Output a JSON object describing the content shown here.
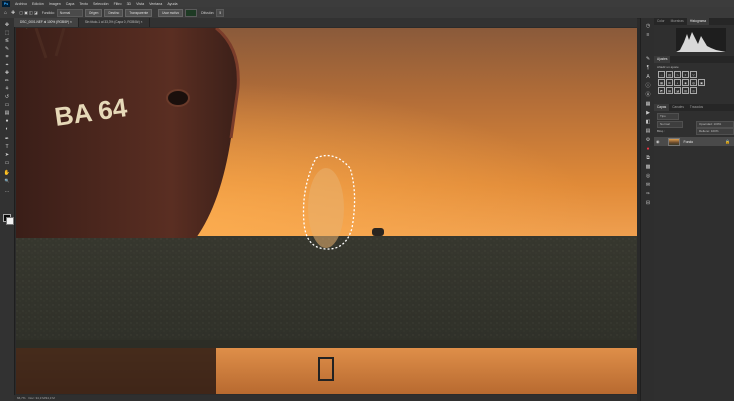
{
  "app": {
    "logo": "Ps"
  },
  "menu": [
    "Archivo",
    "Edición",
    "Imagen",
    "Capa",
    "Texto",
    "Selección",
    "Filtro",
    "3D",
    "Vista",
    "Ventana",
    "Ayuda"
  ],
  "options": {
    "feather_label": "Fundido:",
    "feather_value": "Normal",
    "origin_label": "Origen",
    "dest_label": "Destino",
    "transparent_label": "Transparente",
    "use_pattern_label": "Usar motivo",
    "spread_label": "Difusión:",
    "spread_value": "5"
  },
  "tabs": [
    {
      "label": "DSC_0001.NEF al 100% (RGB/8*) ×",
      "active": true
    },
    {
      "label": "Sin título-1 al 33,3% (Capa 0, RGB/8#) × ",
      "active": false
    }
  ],
  "canvas": {
    "boat_text": "BA 64"
  },
  "status": {
    "zoom": "66,7%",
    "doc": "Doc: 34,3 M/34,3 M"
  },
  "panels": {
    "top_tabs": [
      "Color",
      "Muestras",
      "Histograma"
    ],
    "adjust_tabs": [
      "Ajustes"
    ],
    "adjust_hint": "Añadir un ajuste",
    "layer_tabs": [
      "Capas",
      "Canales",
      "Trazados"
    ],
    "layer_search": "Tipo",
    "blend_mode": "Normal",
    "opacity": "Opacidad: 100%",
    "lock_label": "Bloq.:",
    "fill_label": "Relleno: 100%",
    "layer_name": "Fondo"
  },
  "icons": {
    "tools": [
      "move-icon",
      "marquee-icon",
      "lasso-icon",
      "quick-select-icon",
      "crop-icon",
      "eyedropper-icon",
      "healing-icon",
      "brush-icon",
      "stamp-icon",
      "history-brush-icon",
      "eraser-icon",
      "gradient-icon",
      "blur-icon",
      "dodge-icon",
      "pen-icon",
      "type-icon",
      "path-select-icon",
      "shape-icon",
      "hand-icon",
      "zoom-icon",
      "more-tools-icon"
    ],
    "tool_glyphs": [
      "✥",
      "⬚",
      "ᓬ",
      "✎",
      "⌗",
      "⌖",
      "✚",
      "✏",
      "⚘",
      "↺",
      "▭",
      "▤",
      "●",
      "◐",
      "✒",
      "T",
      "➤",
      "▭",
      "✋",
      "🔍",
      "…"
    ]
  },
  "colors": {
    "accent": "#31a8ff",
    "panel": "#2f2f2f",
    "selected_layer": "#4a4a4a"
  }
}
